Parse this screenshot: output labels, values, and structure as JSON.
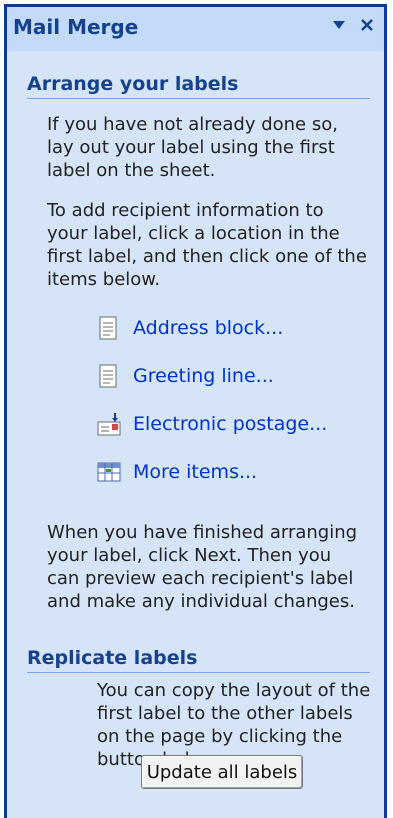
{
  "pane": {
    "title": "Mail Merge",
    "menu_icon": "chevron-down-icon",
    "close_icon": "close-icon"
  },
  "arrange": {
    "heading": "Arrange your labels",
    "para1": "If you have not already done so, lay out your label using the first label on the sheet.",
    "para2": "To add recipient information to your label, click a location in the first label, and then click one of the items below.",
    "links": [
      {
        "label": "Address block...",
        "icon": "document-icon"
      },
      {
        "label": "Greeting line...",
        "icon": "document-icon"
      },
      {
        "label": "Electronic postage...",
        "icon": "postage-icon"
      },
      {
        "label": "More items...",
        "icon": "database-fields-icon"
      }
    ],
    "para3": "When you have finished arranging your label, click Next. Then you can preview each recipient's label and make any individual changes."
  },
  "replicate": {
    "heading": "Replicate labels",
    "para": "You can copy the layout of the first label to the other labels on the page by clicking the button below.",
    "button_label": "Update all labels"
  },
  "colors": {
    "pane_border": "#0b3a9c",
    "heading_text": "#15428b",
    "link_text": "#0033cc",
    "content_bg": "#d6e4f7"
  }
}
